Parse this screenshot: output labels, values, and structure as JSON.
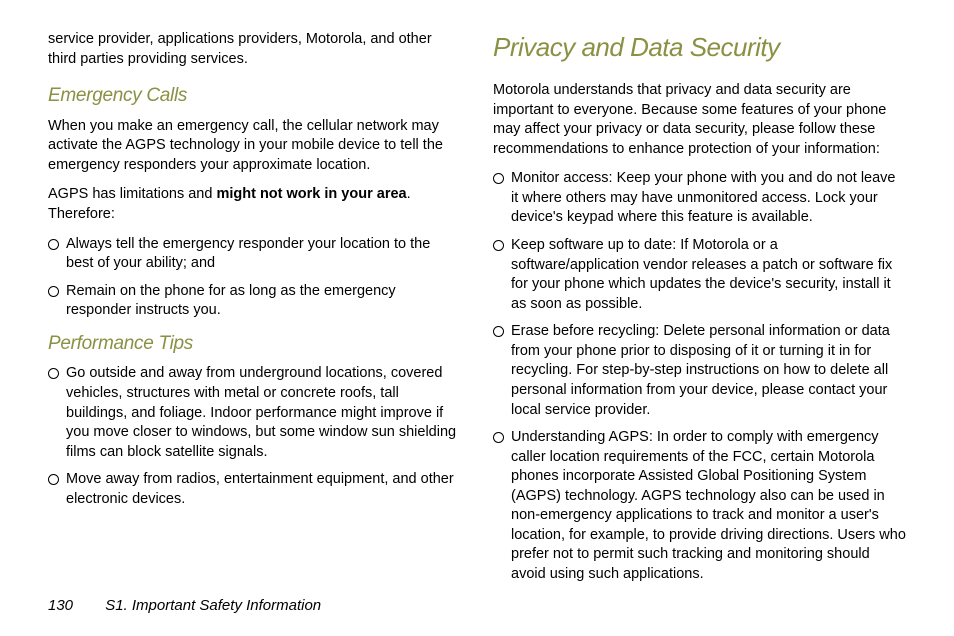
{
  "left": {
    "intro": "service provider, applications providers, Motorola, and other third parties providing services.",
    "h_emergency": "Emergency Calls",
    "emergency_p1": "When you make an emergency call, the cellular network may activate the AGPS technology in your mobile device to tell the emergency responders your approximate location.",
    "emergency_p2_pre": "AGPS has limitations and ",
    "emergency_p2_bold": "might not work in your area",
    "emergency_p2_post": ". Therefore:",
    "emergency_bullets": [
      "Always tell the emergency responder your location to the best of your ability; and",
      "Remain on the phone for as long as the emergency responder instructs you."
    ],
    "h_performance": "Performance Tips",
    "performance_bullets": [
      "Go outside and away from underground locations, covered vehicles, structures with metal or concrete roofs, tall buildings, and foliage. Indoor performance might improve if you move closer to windows, but some window sun shielding films can block satellite signals.",
      "Move away from radios, entertainment equipment, and other electronic devices."
    ]
  },
  "right": {
    "h_main": "Privacy and Data Security",
    "intro": "Motorola understands that privacy and data security are important to everyone. Because some features of your phone may affect your privacy or data security, please follow these recommendations to enhance protection of your information:",
    "bullets": [
      "Monitor access: Keep your phone with you and do not leave it where others may have unmonitored access. Lock your device's keypad where this feature is available.",
      "Keep software up to date: If Motorola or a software/application vendor releases a patch or software fix for your phone which updates the device's security, install it as soon as possible.",
      "Erase before recycling: Delete personal information or data from your phone prior to disposing of it or turning it in for recycling. For step-by-step instructions on how to delete all personal information from your device, please contact your local service provider.",
      "Understanding AGPS: In order to comply with emergency caller location requirements of the FCC, certain Motorola phones incorporate Assisted Global Positioning System (AGPS) technology. AGPS technology also can be used in non-emergency applications to track and monitor a user's location, for example, to provide driving directions. Users who prefer not to permit such tracking and monitoring should avoid using such applications."
    ]
  },
  "footer": {
    "page": "130",
    "section": "S1. Important Safety Information"
  }
}
